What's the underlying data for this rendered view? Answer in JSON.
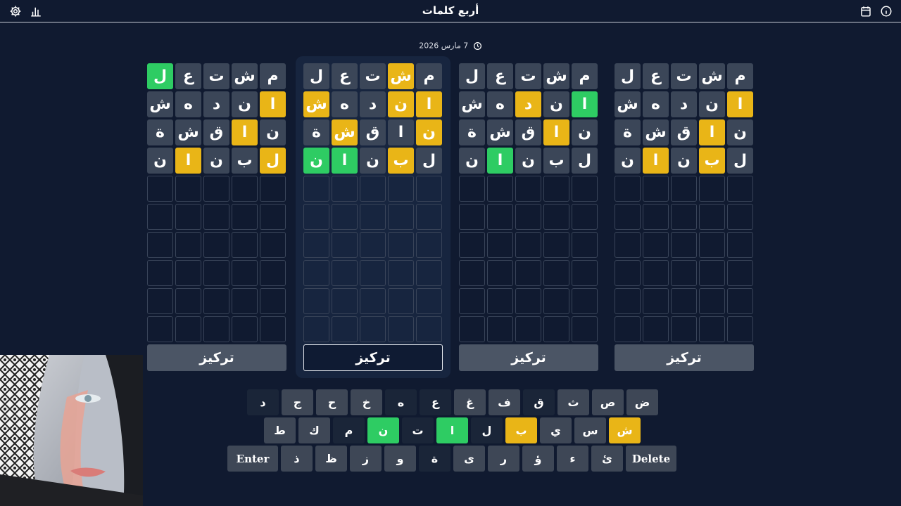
{
  "header": {
    "title": "أربع كلمات"
  },
  "date": {
    "text": "7 مارس 2026"
  },
  "guesses": [
    {
      "letters": [
        "م",
        "ش",
        "ت",
        "ع",
        "ل"
      ]
    },
    {
      "letters": [
        "ا",
        "ن",
        "د",
        "ه",
        "ش"
      ]
    },
    {
      "letters": [
        "ن",
        "ا",
        "ق",
        "ش",
        "ة"
      ]
    },
    {
      "letters": [
        "ل",
        "ب",
        "ن",
        "ا",
        "ن"
      ]
    }
  ],
  "boards": [
    {
      "name": "board-1",
      "focused": false,
      "focus_label": "تركيز",
      "states": [
        [
          "a",
          "a",
          "a",
          "a",
          "c"
        ],
        [
          "p",
          "a",
          "a",
          "a",
          "a"
        ],
        [
          "a",
          "p",
          "a",
          "a",
          "a"
        ],
        [
          "p",
          "a",
          "a",
          "p",
          "a"
        ]
      ]
    },
    {
      "name": "board-2",
      "focused": true,
      "focus_label": "تركيز",
      "states": [
        [
          "a",
          "p",
          "a",
          "a",
          "a"
        ],
        [
          "p",
          "p",
          "a",
          "a",
          "p"
        ],
        [
          "p",
          "a",
          "a",
          "p",
          "a"
        ],
        [
          "a",
          "p",
          "a",
          "c",
          "c"
        ]
      ]
    },
    {
      "name": "board-3",
      "focused": false,
      "focus_label": "تركيز",
      "states": [
        [
          "a",
          "a",
          "a",
          "a",
          "a"
        ],
        [
          "c",
          "a",
          "p",
          "a",
          "a"
        ],
        [
          "a",
          "p",
          "a",
          "a",
          "a"
        ],
        [
          "a",
          "a",
          "a",
          "c",
          "a"
        ]
      ]
    },
    {
      "name": "board-4",
      "focused": false,
      "focus_label": "تركيز",
      "states": [
        [
          "a",
          "a",
          "a",
          "a",
          "a"
        ],
        [
          "p",
          "a",
          "a",
          "a",
          "a"
        ],
        [
          "a",
          "p",
          "a",
          "a",
          "a"
        ],
        [
          "a",
          "p",
          "a",
          "p",
          "a"
        ]
      ]
    }
  ],
  "grid": {
    "rows": 10,
    "cols": 5
  },
  "keyboard": {
    "rows": [
      [
        {
          "label": "ض",
          "state": "def"
        },
        {
          "label": "ص",
          "state": "def"
        },
        {
          "label": "ث",
          "state": "def"
        },
        {
          "label": "ق",
          "state": "absent"
        },
        {
          "label": "ف",
          "state": "def"
        },
        {
          "label": "غ",
          "state": "def"
        },
        {
          "label": "ع",
          "state": "absent"
        },
        {
          "label": "ه",
          "state": "absent"
        },
        {
          "label": "خ",
          "state": "def"
        },
        {
          "label": "ح",
          "state": "def"
        },
        {
          "label": "ج",
          "state": "def"
        },
        {
          "label": "د",
          "state": "absent"
        }
      ],
      [
        {
          "label": "ش",
          "state": "present"
        },
        {
          "label": "س",
          "state": "def"
        },
        {
          "label": "ي",
          "state": "def"
        },
        {
          "label": "ب",
          "state": "present"
        },
        {
          "label": "ل",
          "state": "absent"
        },
        {
          "label": "ا",
          "state": "correct"
        },
        {
          "label": "ت",
          "state": "absent"
        },
        {
          "label": "ن",
          "state": "correct"
        },
        {
          "label": "م",
          "state": "absent"
        },
        {
          "label": "ك",
          "state": "def"
        },
        {
          "label": "ط",
          "state": "def"
        }
      ],
      [
        {
          "label": "Delete",
          "state": "def",
          "wide": true
        },
        {
          "label": "ئ",
          "state": "def"
        },
        {
          "label": "ء",
          "state": "def"
        },
        {
          "label": "ؤ",
          "state": "def"
        },
        {
          "label": "ر",
          "state": "def"
        },
        {
          "label": "ى",
          "state": "def"
        },
        {
          "label": "ة",
          "state": "absent"
        },
        {
          "label": "و",
          "state": "def"
        },
        {
          "label": "ز",
          "state": "def"
        },
        {
          "label": "ظ",
          "state": "def"
        },
        {
          "label": "ذ",
          "state": "def"
        },
        {
          "label": "Enter",
          "state": "def",
          "wide": true
        }
      ]
    ]
  },
  "icons": {
    "settings": "gear-icon",
    "stats": "bar-chart-icon",
    "calendar": "calendar-icon",
    "info": "info-icon",
    "clock": "clock-icon"
  },
  "colors": {
    "background": "#101a30",
    "absent": "#3b4658",
    "present": "#e9b517",
    "correct": "#2ecc63",
    "key_default": "#3e4756",
    "key_absent": "#1a2538"
  }
}
